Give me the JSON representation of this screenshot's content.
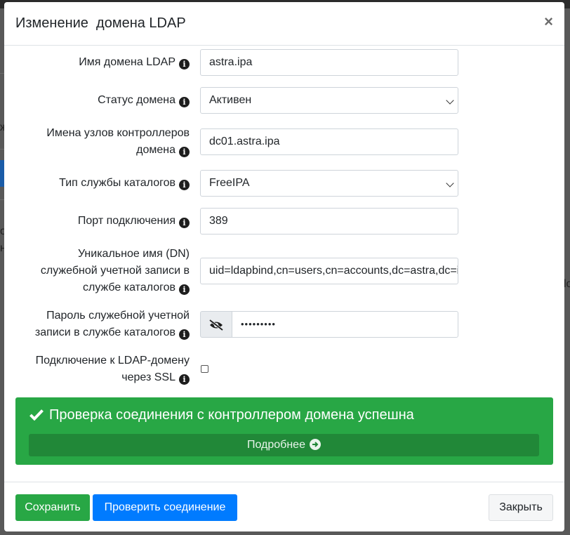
{
  "modal": {
    "title": "Изменение  домена LDAP",
    "close_glyph": "×"
  },
  "form": {
    "domain_name": {
      "label": "Имя домена LDAP",
      "value": "astra.ipa"
    },
    "domain_status": {
      "label": "Статус домена",
      "value": "Активен"
    },
    "controller_hosts": {
      "label_line1": "Имена узлов контроллеров",
      "label_line2": "домена",
      "value": "dc01.astra.ipa"
    },
    "directory_type": {
      "label": "Тип службы каталогов",
      "value": "FreeIPA"
    },
    "port": {
      "label": "Порт подключения",
      "value": "389"
    },
    "bind_dn": {
      "label_line1": "Уникальное имя (DN)",
      "label_line2": "служебной учетной записи в",
      "label_line3": "службе каталогов",
      "value": "uid=ldapbind,cn=users,cn=accounts,dc=astra,dc=ipa"
    },
    "password": {
      "label_line1": "Пароль служебной учетной",
      "label_line2": "записи в службе каталогов",
      "value": "•••••••••"
    },
    "ssl": {
      "label_line1": "Подключение к LDAP-домену",
      "label_line2": "через SSL",
      "checked": false
    }
  },
  "alert": {
    "message": "Проверка соединения с контроллером домена успешна",
    "details_label": "Подробнее",
    "color": "#28a745"
  },
  "footer": {
    "save_label": "Сохранить",
    "check_label": "Проверить соединение",
    "close_label": "Закрыть"
  },
  "icons": {
    "info": "info-circle-icon",
    "eye": "eye-slash-icon",
    "check": "check-icon",
    "details": "arrow-circle-right-icon"
  },
  "backdrop": {
    "glyph_1": "ж",
    "glyph_2": "о",
    "glyph_3": "н",
    "glyph_4": "lo"
  }
}
